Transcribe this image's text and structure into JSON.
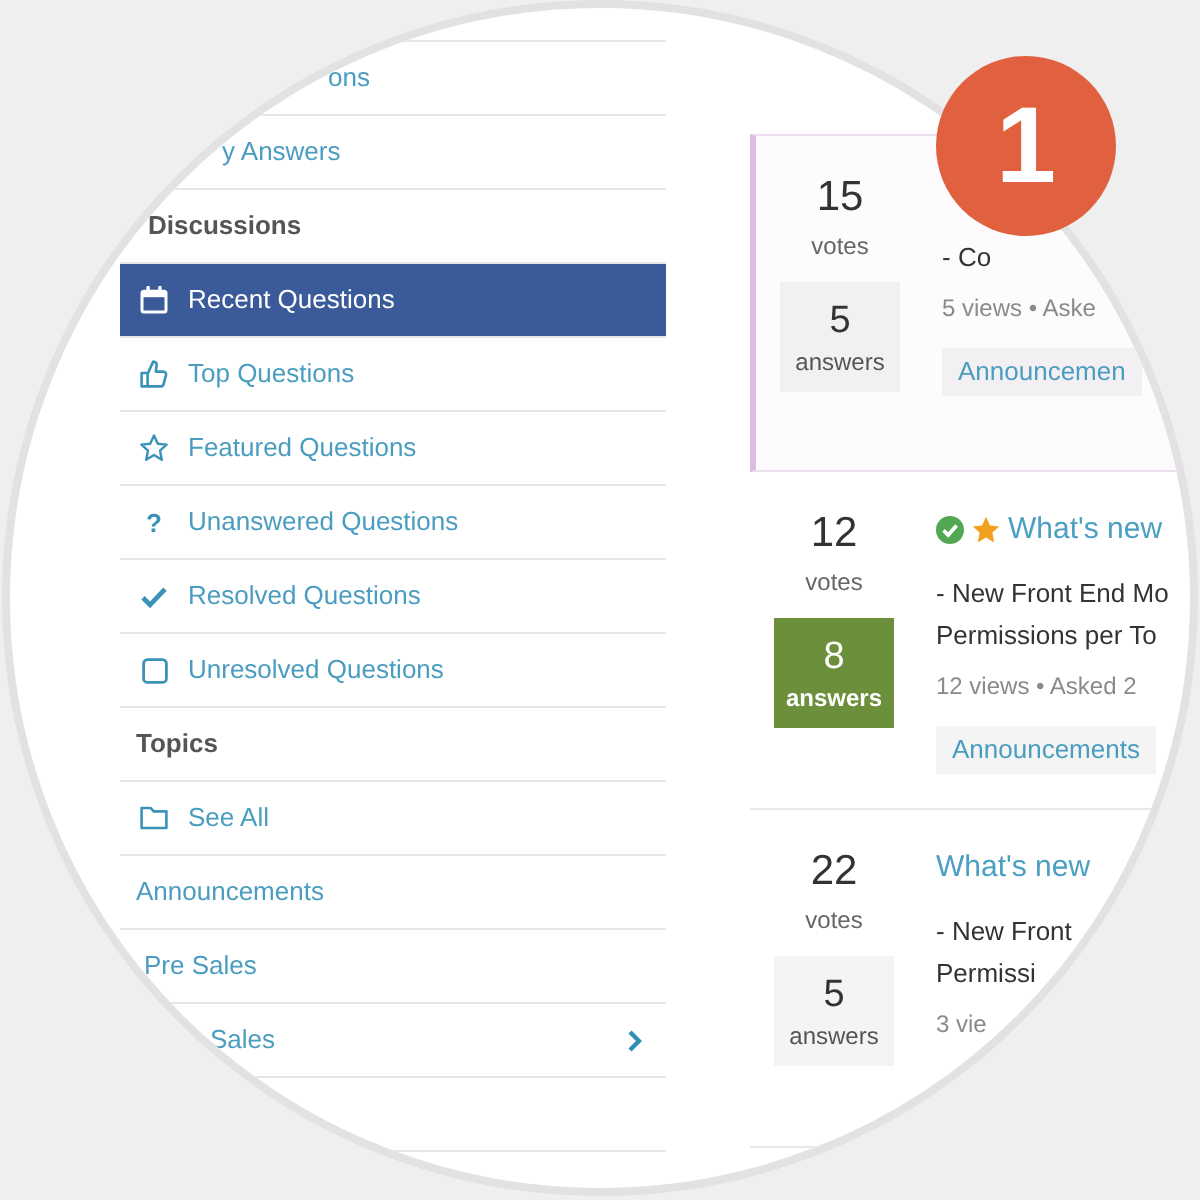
{
  "step_badge": "1",
  "sidebar": {
    "sections": [
      {
        "items": [
          {
            "label": "ons",
            "selected": false
          },
          {
            "label": "y Answers",
            "selected": false
          }
        ]
      },
      {
        "heading": "Discussions",
        "items": [
          {
            "label": "Recent Questions",
            "selected": true
          },
          {
            "label": "Top Questions",
            "selected": false
          },
          {
            "label": "Featured Questions",
            "selected": false
          },
          {
            "label": "Unanswered Questions",
            "selected": false,
            "glyph": "?"
          },
          {
            "label": "Resolved Questions",
            "selected": false
          },
          {
            "label": "Unresolved Questions",
            "selected": false
          }
        ]
      },
      {
        "heading": "Topics",
        "items": [
          {
            "label": "See All",
            "selected": false
          },
          {
            "label": "Announcements",
            "selected": false
          },
          {
            "label": "Pre Sales",
            "selected": false
          },
          {
            "label": "Sales",
            "selected": false,
            "expanded": false
          }
        ]
      }
    ]
  },
  "questions": [
    {
      "highlighted": true,
      "votes": "15",
      "votes_label": "votes",
      "answers": "5",
      "answers_label": "answers",
      "accepted_answer": false,
      "resolved": false,
      "featured": false,
      "excerpt": "- Co",
      "meta": "5 views • Aske",
      "tags": [
        "Announcemen"
      ]
    },
    {
      "highlighted": false,
      "votes": "12",
      "votes_label": "votes",
      "answers": "8",
      "answers_label": "answers",
      "accepted_answer": true,
      "resolved": true,
      "featured": true,
      "title": "What's new",
      "excerpt": "- New Front End Mo\nPermissions per To",
      "meta": "12 views • Asked 2",
      "tags": [
        "Announcements"
      ]
    },
    {
      "highlighted": false,
      "votes": "22",
      "votes_label": "votes",
      "answers": "5",
      "answers_label": "answers",
      "accepted_answer": false,
      "resolved": false,
      "featured": false,
      "title": "What's new",
      "excerpt": "- New Front\nPermissi",
      "meta": "3 vie"
    }
  ]
}
